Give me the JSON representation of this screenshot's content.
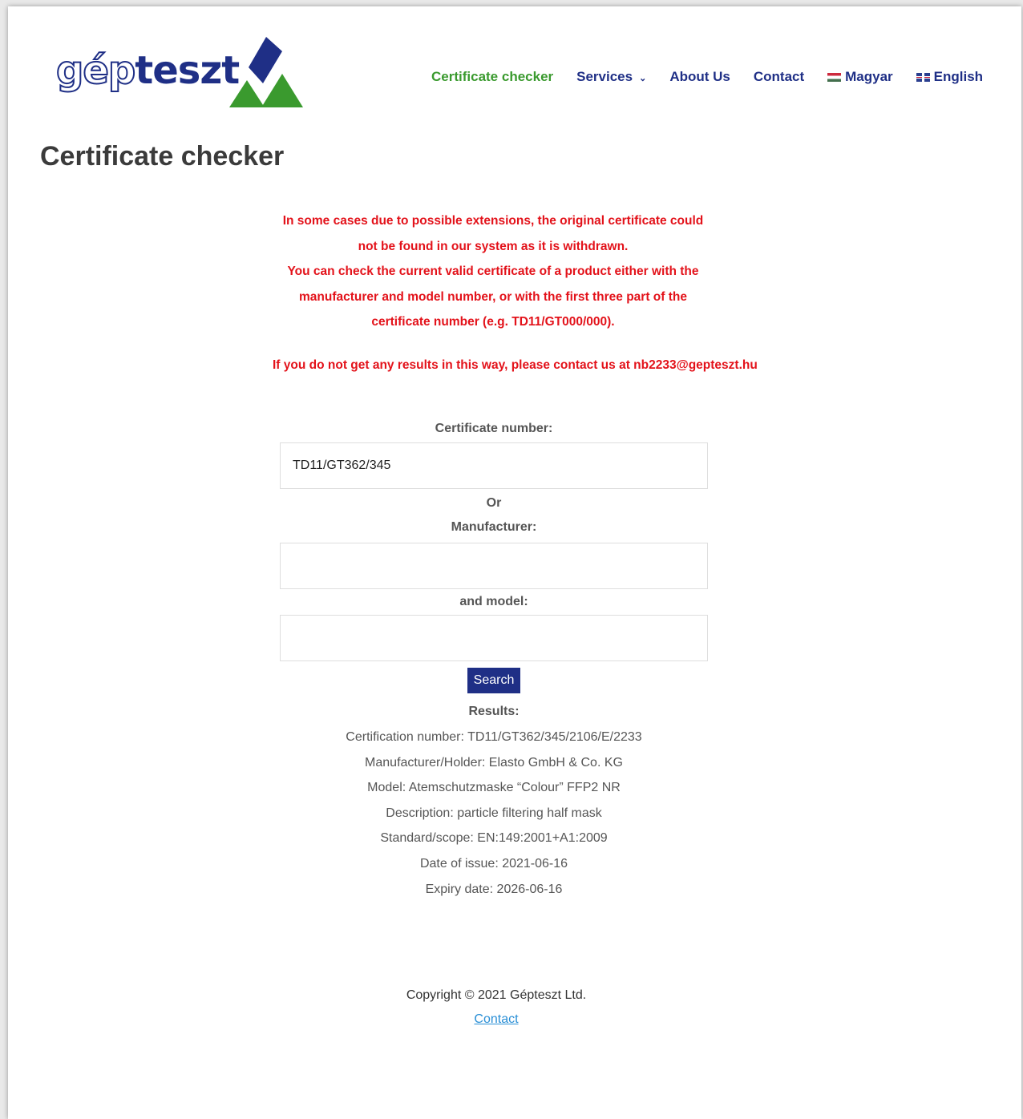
{
  "header": {
    "logo_text_outline": "gép",
    "logo_text_solid": "teszt",
    "nav": [
      {
        "label": "Certificate checker",
        "active": true
      },
      {
        "label": "Services",
        "has_dropdown": true
      },
      {
        "label": "About Us"
      },
      {
        "label": "Contact"
      },
      {
        "label": "Magyar",
        "flag": "hungarian-flag-icon"
      },
      {
        "label": "English",
        "flag": "uk-flag-icon"
      }
    ]
  },
  "page": {
    "title": "Certificate checker"
  },
  "notice": {
    "line1": "In some cases due to possible extensions, the original certificate could not be found in our system as it is withdrawn.",
    "line2": "You can check the current valid certificate of a product either with the manufacturer and model number, or with the first three part of the certificate number (e.g. TD11/GT000/000).",
    "line3": "If you do not get any results in this way, please contact us at nb2233@gepteszt.hu"
  },
  "form": {
    "certificate_label": "Certificate number:",
    "certificate_value": "TD11/GT362/345",
    "or_label": "Or",
    "manufacturer_label": "Manufacturer:",
    "manufacturer_value": "",
    "model_label": "and model:",
    "model_value": "",
    "search_label": "Search"
  },
  "results": {
    "heading": "Results:",
    "lines": [
      "Certification number: TD11/GT362/345/2106/E/2233",
      "Manufacturer/Holder: Elasto GmbH & Co. KG",
      "Model: Atemschutzmaske “Colour” FFP2 NR",
      "Description: particle filtering half mask",
      "Standard/scope: EN:149:2001+A1:2009",
      "Date of issue: 2021-06-16",
      "Expiry date: 2026-06-16"
    ]
  },
  "footer": {
    "copyright": "Copyright © 2021 Gépteszt Ltd.",
    "contact_link": "Contact"
  },
  "colors": {
    "brand_blue": "#1f2f86",
    "brand_green": "#3a9a2e",
    "notice_red": "#e3121a",
    "link_blue": "#2a8fd6"
  }
}
